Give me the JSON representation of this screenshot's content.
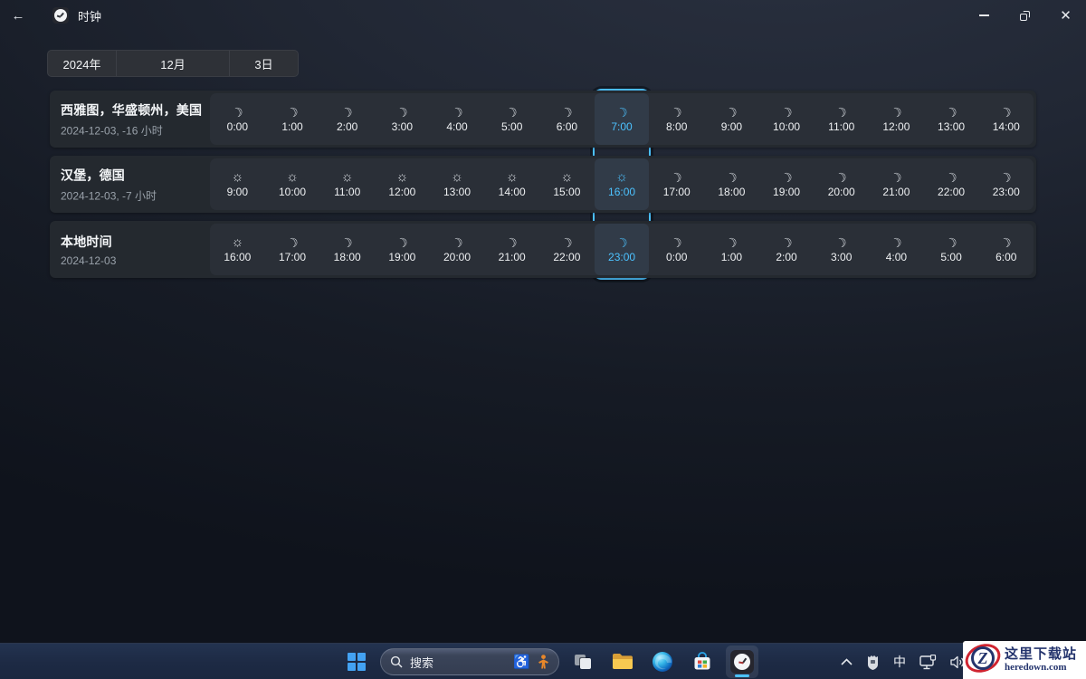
{
  "titlebar": {
    "title": "时钟",
    "back_glyph": "←",
    "close_glyph": "✕"
  },
  "datebar": {
    "year": "2024年",
    "month": "12月",
    "day": "3日"
  },
  "accent_color": "#4cc2ff",
  "icon_glyphs": {
    "moon": "☽",
    "sun": "☼",
    "wheelchair": "♿"
  },
  "selected_index": 7,
  "rows": [
    {
      "city": "西雅图，华盛顿州，美国",
      "sub": "2024-12-03, -16 小时",
      "cells": [
        {
          "time": "0:00",
          "icon": "moon"
        },
        {
          "time": "1:00",
          "icon": "moon"
        },
        {
          "time": "2:00",
          "icon": "moon"
        },
        {
          "time": "3:00",
          "icon": "moon"
        },
        {
          "time": "4:00",
          "icon": "moon"
        },
        {
          "time": "5:00",
          "icon": "moon"
        },
        {
          "time": "6:00",
          "icon": "moon"
        },
        {
          "time": "7:00",
          "icon": "moon"
        },
        {
          "time": "8:00",
          "icon": "moon"
        },
        {
          "time": "9:00",
          "icon": "moon"
        },
        {
          "time": "10:00",
          "icon": "moon"
        },
        {
          "time": "11:00",
          "icon": "moon"
        },
        {
          "time": "12:00",
          "icon": "moon"
        },
        {
          "time": "13:00",
          "icon": "moon"
        },
        {
          "time": "14:00",
          "icon": "moon"
        }
      ]
    },
    {
      "city": "汉堡，德国",
      "sub": "2024-12-03, -7 小时",
      "cells": [
        {
          "time": "9:00",
          "icon": "sun"
        },
        {
          "time": "10:00",
          "icon": "sun"
        },
        {
          "time": "11:00",
          "icon": "sun"
        },
        {
          "time": "12:00",
          "icon": "sun"
        },
        {
          "time": "13:00",
          "icon": "sun"
        },
        {
          "time": "14:00",
          "icon": "sun"
        },
        {
          "time": "15:00",
          "icon": "sun"
        },
        {
          "time": "16:00",
          "icon": "sun"
        },
        {
          "time": "17:00",
          "icon": "moon"
        },
        {
          "time": "18:00",
          "icon": "moon"
        },
        {
          "time": "19:00",
          "icon": "moon"
        },
        {
          "time": "20:00",
          "icon": "moon"
        },
        {
          "time": "21:00",
          "icon": "moon"
        },
        {
          "time": "22:00",
          "icon": "moon"
        },
        {
          "time": "23:00",
          "icon": "moon"
        }
      ]
    },
    {
      "city": "本地时间",
      "sub": "2024-12-03",
      "cells": [
        {
          "time": "16:00",
          "icon": "sun"
        },
        {
          "time": "17:00",
          "icon": "moon"
        },
        {
          "time": "18:00",
          "icon": "moon"
        },
        {
          "time": "19:00",
          "icon": "moon"
        },
        {
          "time": "20:00",
          "icon": "moon"
        },
        {
          "time": "21:00",
          "icon": "moon"
        },
        {
          "time": "22:00",
          "icon": "moon"
        },
        {
          "time": "23:00",
          "icon": "moon"
        },
        {
          "time": "0:00",
          "icon": "moon"
        },
        {
          "time": "1:00",
          "icon": "moon"
        },
        {
          "time": "2:00",
          "icon": "moon"
        },
        {
          "time": "3:00",
          "icon": "moon"
        },
        {
          "time": "4:00",
          "icon": "moon"
        },
        {
          "time": "5:00",
          "icon": "moon"
        },
        {
          "time": "6:00",
          "icon": "moon"
        }
      ]
    }
  ],
  "taskbar": {
    "search_placeholder": "搜索",
    "ime_indicator": "中"
  },
  "watermark": {
    "letter": "Z",
    "title": "这里下载站",
    "domain": "heredown.com"
  }
}
